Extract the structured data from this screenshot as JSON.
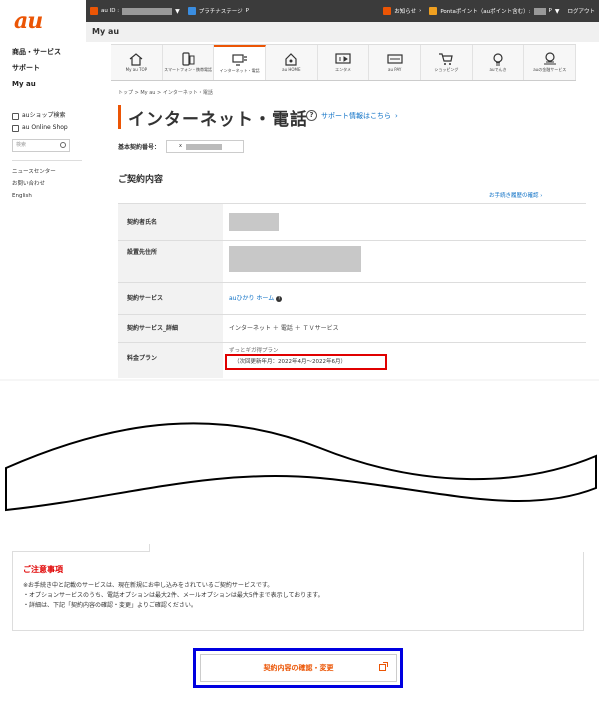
{
  "brand": {
    "logo": "au",
    "accent": "#eb5505",
    "link_color": "#0b6fc5"
  },
  "sidebar": {
    "nav": [
      "商品・サービス",
      "サポート",
      "My au"
    ],
    "links": [
      "auショップ検索",
      "au Online Shop"
    ],
    "search_placeholder": "検索",
    "misc": [
      "ニュースセンター",
      "お問い合わせ",
      "English"
    ]
  },
  "topbar": {
    "au_id_label": "au ID :",
    "platinum": "プラチナステージ",
    "platinum_suffix": "P",
    "news": "お知らせ",
    "ponta": "Pontaポイント（auポイント含む）:",
    "ponta_suffix": "P",
    "logout": "ログアウト"
  },
  "myau": {
    "title": "My au"
  },
  "icon_nav": [
    {
      "label": "My au TOP",
      "icon": "home-icon"
    },
    {
      "label": "スマートフォン・携帯電話",
      "icon": "phone-icon"
    },
    {
      "label": "インターネット・電話",
      "icon": "internet-icon",
      "active": true
    },
    {
      "label": "au HOME",
      "icon": "smart-home-icon"
    },
    {
      "label": "エンタメ",
      "icon": "entertainment-icon"
    },
    {
      "label": "au PAY",
      "icon": "pay-icon"
    },
    {
      "label": "ショッピング",
      "icon": "cart-icon"
    },
    {
      "label": "auでんき",
      "icon": "bulb-icon"
    },
    {
      "label": "auの金融サービス",
      "icon": "finance-icon"
    }
  ],
  "breadcrumb": "トップ > My au > インターネット・電話",
  "page": {
    "title": "インターネット・電話",
    "support_link": "サポート情報はこちら",
    "contract_no_label": "基本契約番号：",
    "contract_no_prefix": "x",
    "section_title": "ご契約内容",
    "history_link": "お手続き履歴の確認"
  },
  "contract_table": {
    "rows": [
      {
        "label": "契約者氏名",
        "value": ""
      },
      {
        "label": "設置先住所",
        "value": ""
      },
      {
        "label": "契約サービス",
        "value": "auひかり ホーム"
      },
      {
        "label": "契約サービス_詳細",
        "value": "インターネット ＋ 電話 ＋ ＴＶサービス"
      },
      {
        "label": "料金プラン",
        "value": "ずっとギガ得プラン",
        "note": "（次回更新年月：2022年4月〜2022年6月）"
      }
    ]
  },
  "notice": {
    "title": "ご注意事項",
    "lines": [
      "※お手続き中と記載のサービスは、現在新規にお申し込みをされているご契約サービスです。",
      "・オプションサービスのうち、電話オプションは最大2件、メールオプションは最大5件まで表示しております。",
      "・詳細は、下記「契約内容の確認・変更」よりご確認ください。"
    ]
  },
  "confirm_button": "契約内容の確認・変更",
  "highlight_colors": {
    "red_box": "#e00000",
    "blue_box": "#0000e0"
  }
}
